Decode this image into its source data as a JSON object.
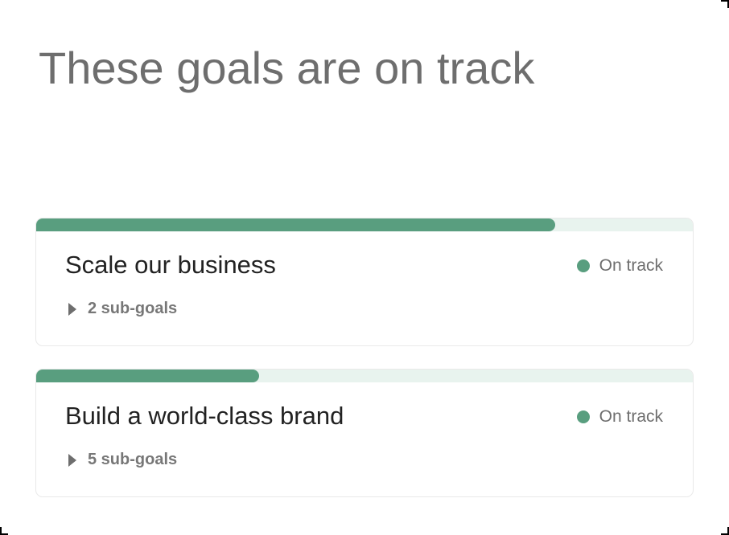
{
  "page": {
    "title": "These goals are on track"
  },
  "colors": {
    "accent": "#599e7f",
    "track": "#e8f3ee",
    "heading_text": "#6e6e6e",
    "title_text": "#222222"
  },
  "goals": [
    {
      "title": "Scale our business",
      "status": "On track",
      "status_icon": "status-dot-icon",
      "progress_percent": 79,
      "subgoals_label": "2 sub-goals",
      "subgoals_icon": "caret-right-icon"
    },
    {
      "title": "Build a world-class brand",
      "status": "On track",
      "status_icon": "status-dot-icon",
      "progress_percent": 34,
      "subgoals_label": "5 sub-goals",
      "subgoals_icon": "caret-right-icon"
    }
  ]
}
